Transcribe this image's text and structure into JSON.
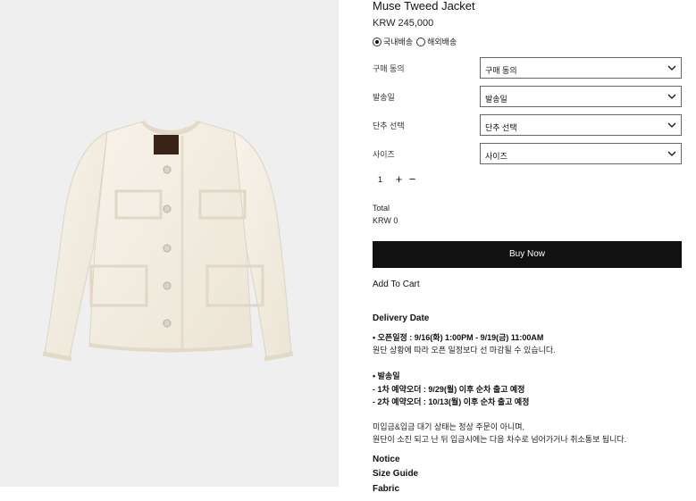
{
  "product": {
    "title": "Muse Tweed Jacket",
    "price": "KRW 245,000",
    "shipping": {
      "domestic": "국내배송",
      "overseas": "해외배송",
      "selected": "domestic"
    }
  },
  "options": [
    {
      "label": "구매 동의",
      "value": "구매 동의"
    },
    {
      "label": "발송일",
      "value": "발송일"
    },
    {
      "label": "단추 선택",
      "value": "단추 선택"
    },
    {
      "label": "사이즈",
      "value": "사이즈"
    }
  ],
  "quantity": {
    "value": "1",
    "plus": "+",
    "minus": "−"
  },
  "total": {
    "label": "Total",
    "value": "KRW 0"
  },
  "buttons": {
    "buy_now": "Buy Now",
    "add_to_cart": "Add To Cart"
  },
  "delivery": {
    "title": "Delivery Date",
    "open_schedule": "• 오픈일정 : 9/16(화) 1:00PM - 9/19(금) 11:00AM",
    "open_note": "원단 상황에 따라 오픈 일정보다 선 마감될 수 있습니다.",
    "ship_title": "• 발송일",
    "ship_first": "- 1차 예약오더 : 9/29(월) 이후 순차 출고 예정",
    "ship_second": "- 2차 예약오더 : 10/13(월) 이후 순차 출고 예정",
    "note_1": "미입금&입금 대기 상태는 정상 주문이 아니며,",
    "note_2": "원단이 소진 되고 난 뒤 입금시에는 다음 차수로 넘어가거나 취소통보 됩니다."
  },
  "links": {
    "notice": "Notice",
    "size_guide": "Size Guide",
    "fabric": "Fabric"
  },
  "colors": {
    "image_bg": "#efefef",
    "jacket": "#f4efe3",
    "label_patch": "#3a2418",
    "button_bg": "#111111"
  },
  "image": {
    "alt_icon": "jacket-product-image"
  }
}
